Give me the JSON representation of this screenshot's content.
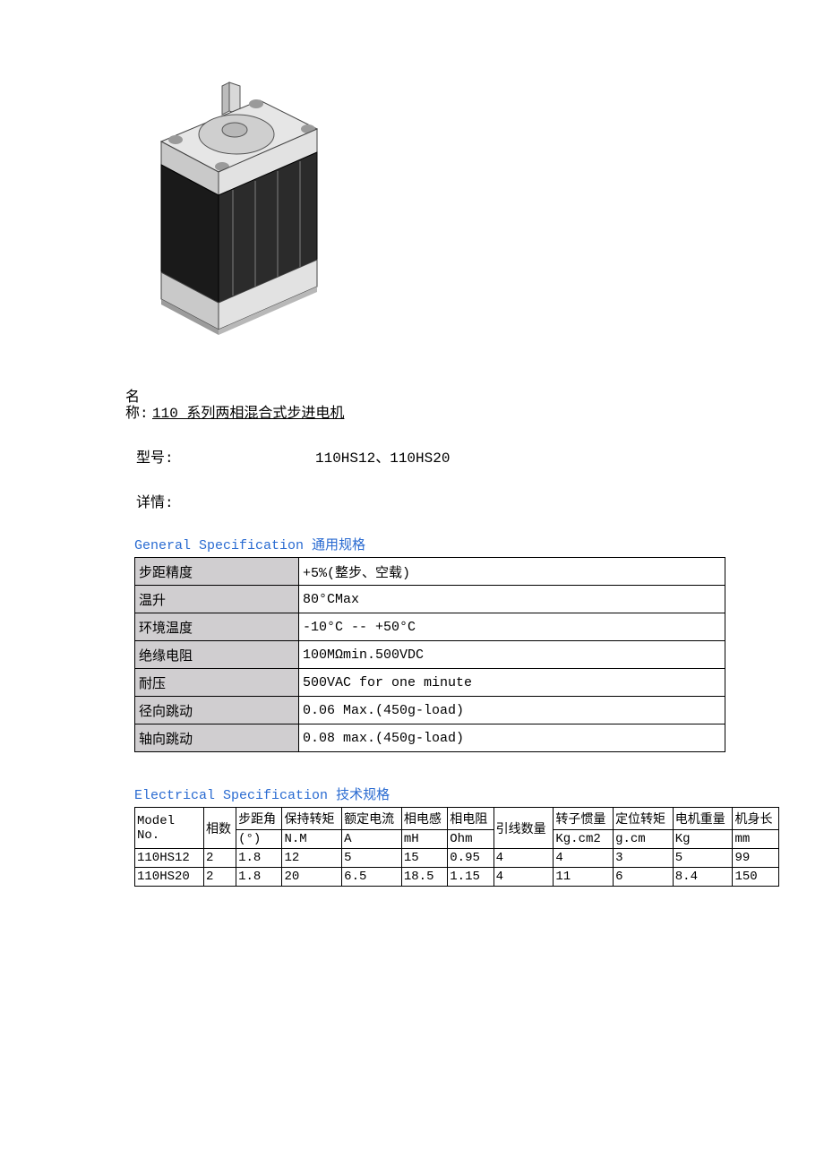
{
  "name_label": "名称:",
  "name_value": "110 系列两相混合式步进电机",
  "model_label": "型号:",
  "model_value": "110HS12、110HS20",
  "details_label": "详情:",
  "gen_title_en": "General Specification",
  "gen_title_cn": "通用规格",
  "general_spec": [
    {
      "label": "步距精度",
      "value": "+5%(整步、空载)"
    },
    {
      "label": "温升",
      "value": "80°CMax"
    },
    {
      "label": "环境温度",
      "value": "-10°C -- +50°C"
    },
    {
      "label": "绝缘电阻",
      "value": "100MΩmin.500VDC"
    },
    {
      "label": "耐压",
      "value": "500VAC for one minute"
    },
    {
      "label": "径向跳动",
      "value": "0.06 Max.(450g-load)"
    },
    {
      "label": "轴向跳动",
      "value": "0.08 max.(450g-load)"
    }
  ],
  "elec_title_en": "Electrical Specification",
  "elec_title_cn": "技术规格",
  "elec_header_model": "Model No.",
  "elec_columns": [
    {
      "label": "相数",
      "unit": ""
    },
    {
      "label": "步距角",
      "unit": "(°)"
    },
    {
      "label": "保持转矩",
      "unit": "N.M"
    },
    {
      "label": "额定电流",
      "unit": "A"
    },
    {
      "label": "相电感",
      "unit": "mH"
    },
    {
      "label": "相电阻",
      "unit": "Ohm"
    },
    {
      "label": "引线数量",
      "unit": ""
    },
    {
      "label": "转子惯量",
      "unit": "Kg.cm2"
    },
    {
      "label": "定位转矩",
      "unit": "g.cm"
    },
    {
      "label": "电机重量",
      "unit": "Kg"
    },
    {
      "label": "机身长",
      "unit": "mm"
    }
  ],
  "elec_rows": [
    {
      "model": "110HS12",
      "vals": [
        "2",
        "1.8",
        "12",
        "5",
        "15",
        "0.95",
        "4",
        "4",
        "3",
        "5",
        "99"
      ]
    },
    {
      "model": "110HS20",
      "vals": [
        "2",
        "1.8",
        "20",
        "6.5",
        "18.5",
        "1.15",
        "4",
        "11",
        "6",
        "8.4",
        "150"
      ]
    }
  ],
  "chart_data": {
    "type": "table",
    "title": "Electrical Specification 技术规格",
    "columns": [
      "Model No.",
      "相数",
      "步距角 (°)",
      "保持转矩 N.M",
      "额定电流 A",
      "相电感 mH",
      "相电阻 Ohm",
      "引线数量",
      "转子惯量 Kg.cm2",
      "定位转矩 g.cm",
      "电机重量 Kg",
      "机身长 mm"
    ],
    "rows": [
      [
        "110HS12",
        2,
        1.8,
        12,
        5,
        15,
        0.95,
        4,
        4,
        3,
        5,
        99
      ],
      [
        "110HS20",
        2,
        1.8,
        20,
        6.5,
        18.5,
        1.15,
        4,
        11,
        6,
        8.4,
        150
      ]
    ]
  }
}
